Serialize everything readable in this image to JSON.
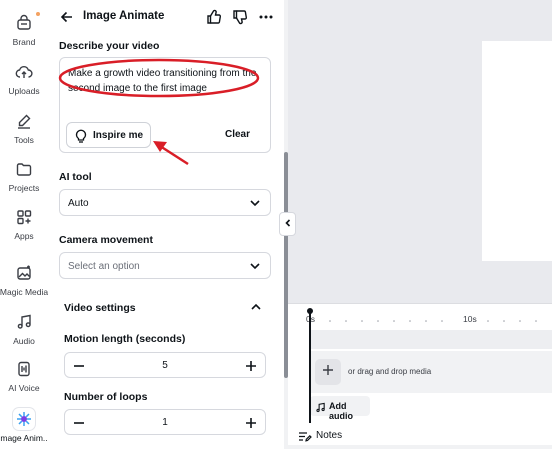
{
  "rail": {
    "items": [
      {
        "label": "Brand",
        "icon": "brand-icon"
      },
      {
        "label": "Uploads",
        "icon": "upload-cloud-icon"
      },
      {
        "label": "Tools",
        "icon": "pen-tool-icon"
      },
      {
        "label": "Projects",
        "icon": "folder-icon"
      },
      {
        "label": "Apps",
        "icon": "apps-grid-icon"
      },
      {
        "label": "Magic Media",
        "icon": "magic-media-icon"
      },
      {
        "label": "Audio",
        "icon": "music-note-icon"
      },
      {
        "label": "AI Voice",
        "icon": "ai-voice-icon"
      },
      {
        "label": "Image Anim...",
        "icon": "image-animate-app-icon"
      }
    ]
  },
  "panel": {
    "title": "Image Animate",
    "describe_label": "Describe your video",
    "description_value": "Make a growth video transitioning from the second image to the first image",
    "inspire_label": "Inspire me",
    "clear_label": "Clear",
    "ai_tool_label": "AI tool",
    "ai_tool_value": "Auto",
    "camera_label": "Camera movement",
    "camera_placeholder": "Select an option",
    "video_settings_label": "Video settings",
    "motion_label": "Motion length (seconds)",
    "motion_value": "5",
    "loops_label": "Number of loops",
    "loops_value": "1"
  },
  "timeline": {
    "start_label": "0s",
    "mid_label": "10s",
    "drag_text": "or drag and drop media",
    "add_audio_label": "Add audio",
    "notes_label": "Notes"
  },
  "colors": {
    "accent_red": "#d91e27",
    "text": "#0e1318",
    "border": "#d6d8de"
  }
}
